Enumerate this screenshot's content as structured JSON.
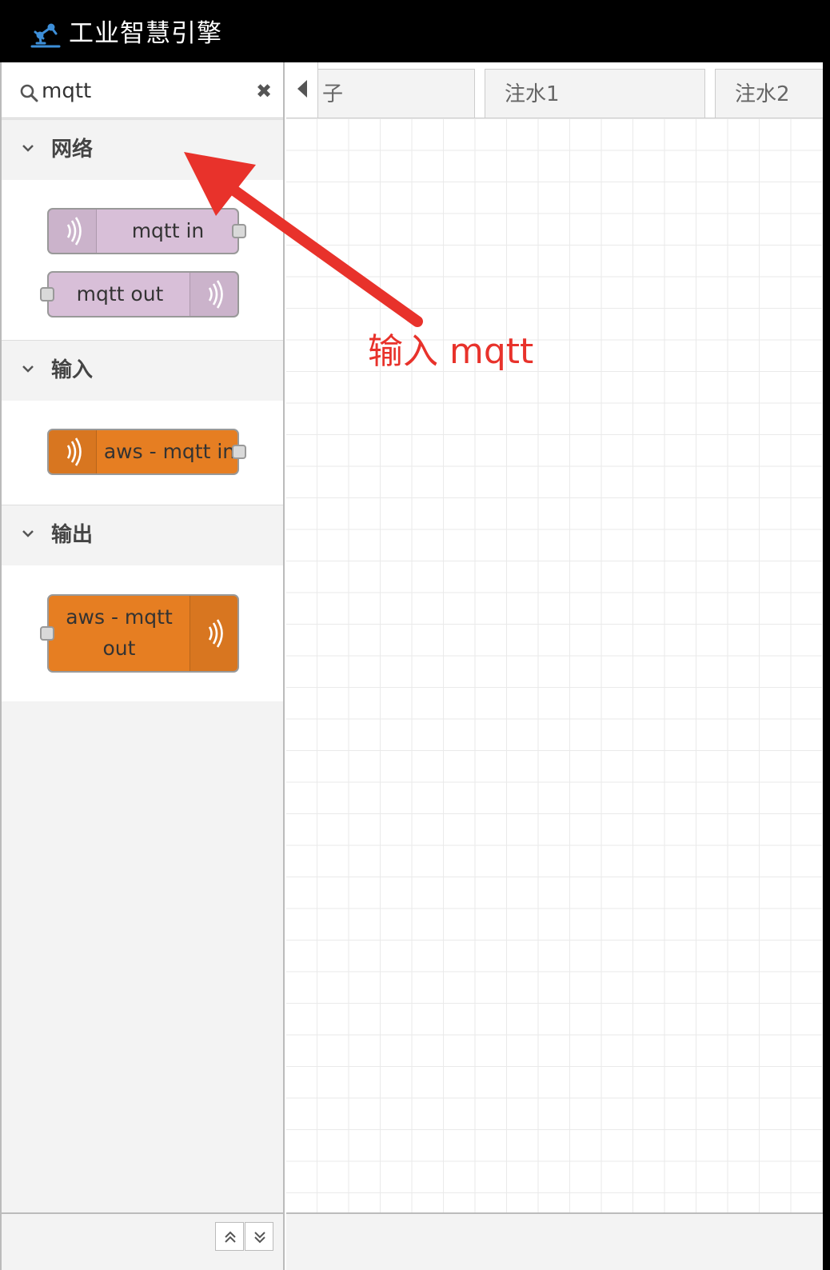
{
  "header": {
    "title": "工业智慧引擎",
    "logo_icon": "robot-arm-icon"
  },
  "search": {
    "value": "mqtt",
    "icon": "search-icon",
    "clear_icon": "close-icon"
  },
  "palette": {
    "categories": [
      {
        "label": "网络",
        "nodes": [
          {
            "label": "mqtt in",
            "color": "#d8bfd8",
            "icon": "wifi-icon"
          },
          {
            "label": "mqtt out",
            "color": "#d8bfd8",
            "icon": "wifi-icon"
          }
        ]
      },
      {
        "label": "输入",
        "nodes": [
          {
            "label": "aws - mqtt in",
            "color": "#e67e22",
            "icon": "wifi-icon"
          }
        ]
      },
      {
        "label": "输出",
        "nodes": [
          {
            "label_line1": "aws - mqtt",
            "label_line2": "out",
            "color": "#e67e22",
            "icon": "wifi-icon"
          }
        ]
      }
    ]
  },
  "tabs": [
    {
      "label": "子"
    },
    {
      "label": "注水1"
    },
    {
      "label": "注水2"
    }
  ],
  "annotation": {
    "text": "输入 mqtt",
    "color": "#e8322b"
  }
}
